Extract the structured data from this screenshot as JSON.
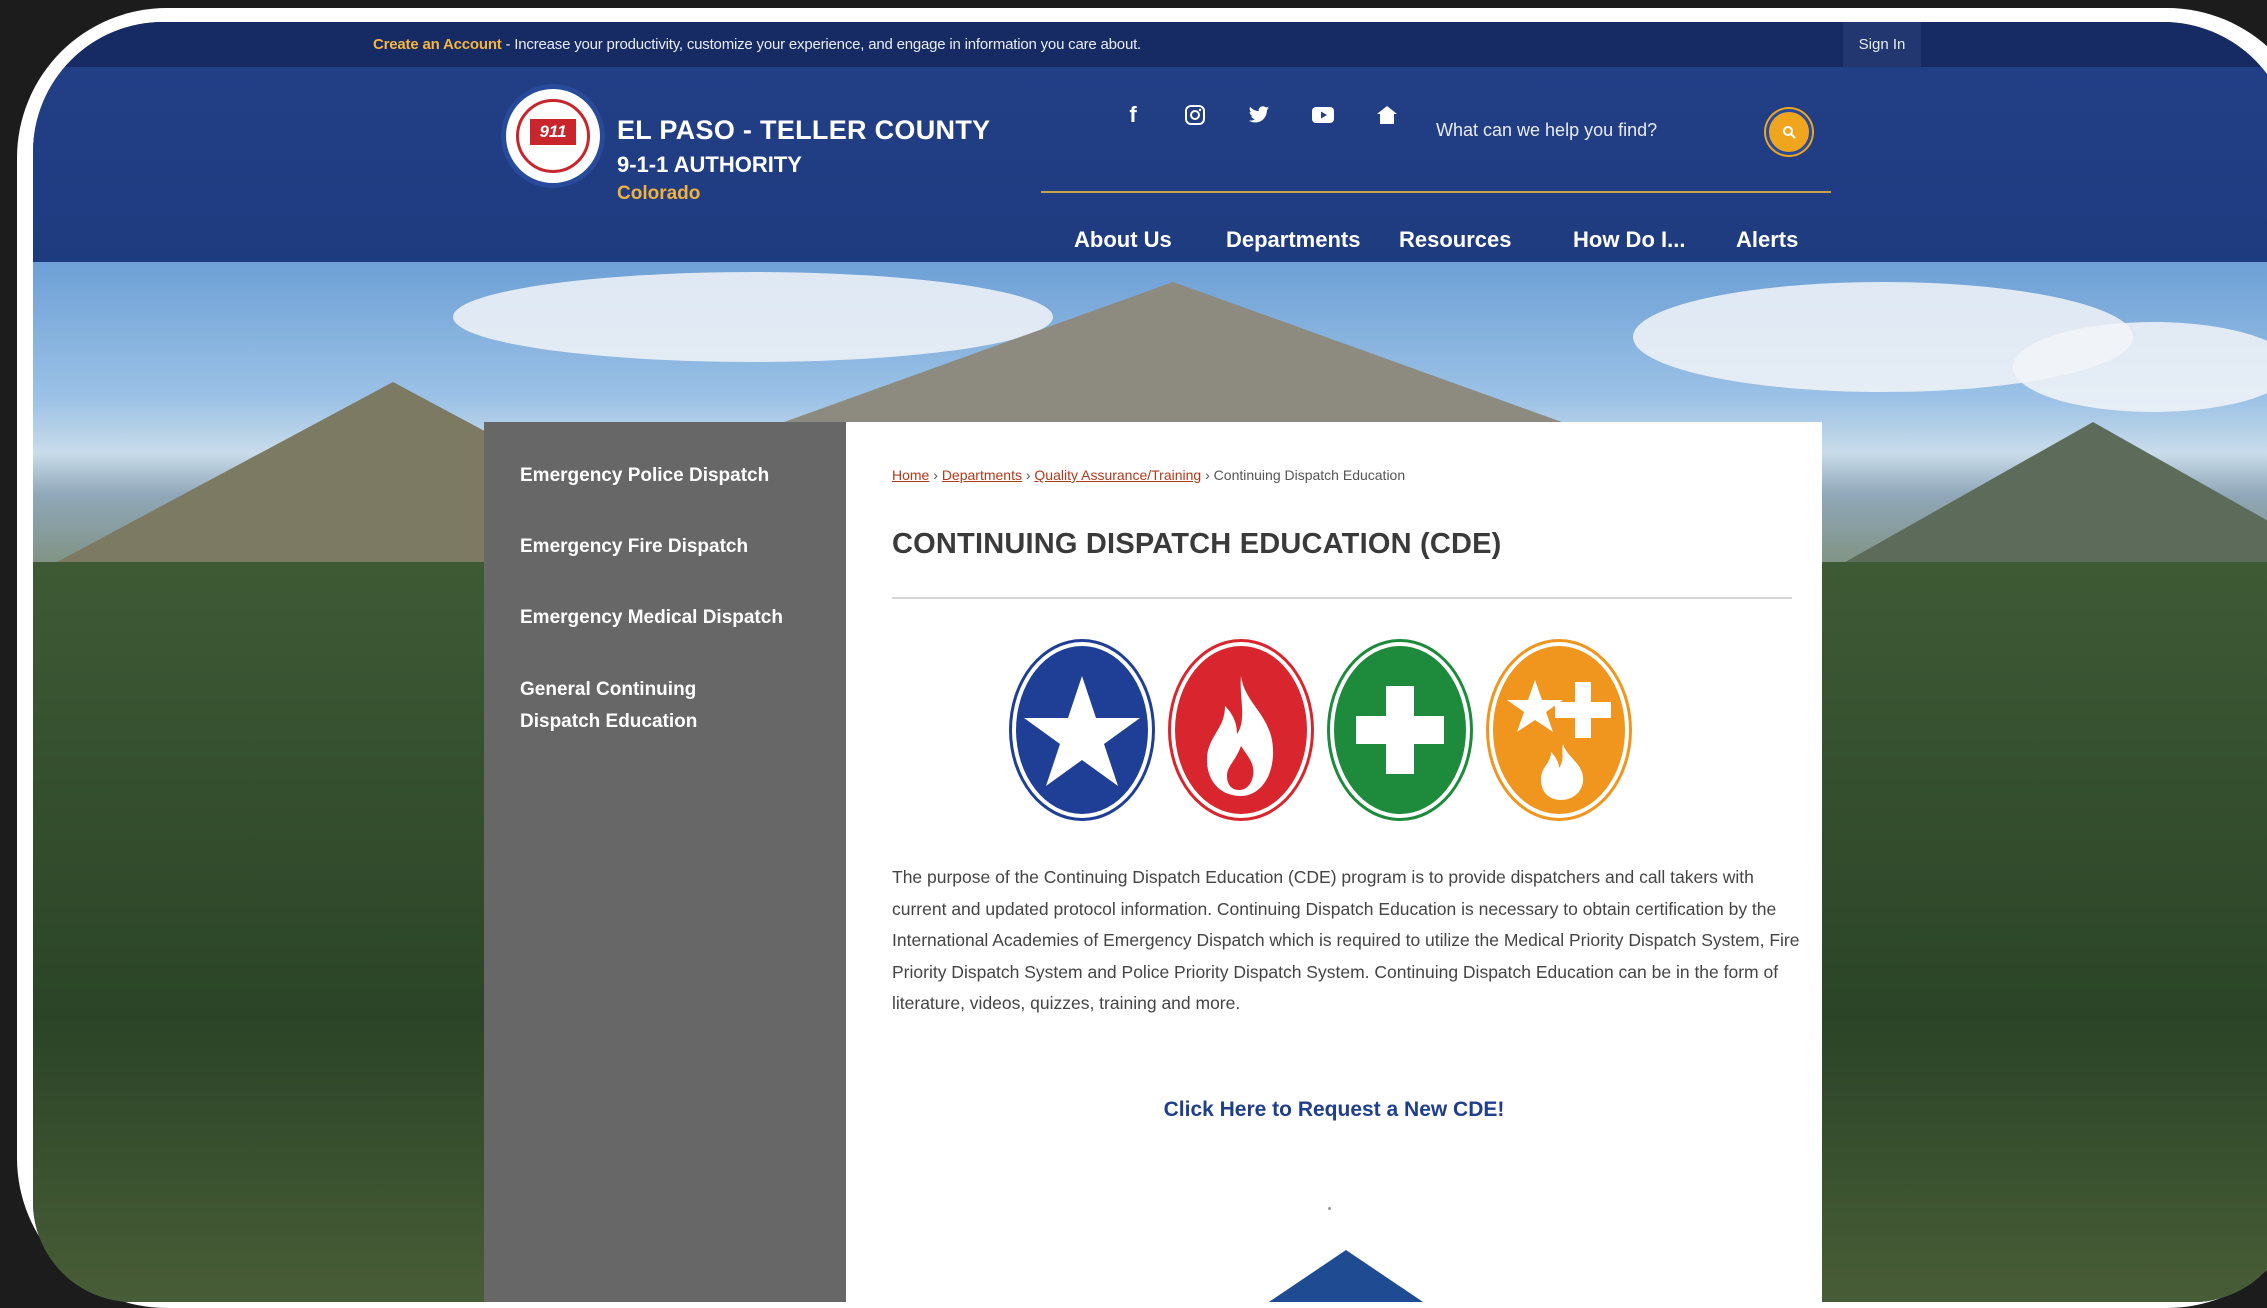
{
  "topbar": {
    "create_account": "Create an Account",
    "promo_text": " - Increase your productivity, customize your experience, and engage in information you care about.",
    "sign_in": "Sign In"
  },
  "header": {
    "org_line1": "EL PASO - TELLER COUNTY",
    "org_line2": "9-1-1 AUTHORITY",
    "org_line3": "Colorado",
    "logo_text": "911",
    "search_placeholder": "What can we help you find?",
    "social_icons": [
      "facebook-icon",
      "instagram-icon",
      "twitter-icon",
      "youtube-icon",
      "nextdoor-icon"
    ]
  },
  "nav": {
    "items": [
      "About Us",
      "Departments",
      "Resources",
      "How Do I...",
      "Alerts"
    ]
  },
  "sidebar": {
    "items": [
      "Emergency Police Dispatch",
      "Emergency Fire Dispatch",
      "Emergency Medical Dispatch",
      "General Continuing Dispatch Education"
    ]
  },
  "breadcrumb": {
    "home": "Home",
    "departments": "Departments",
    "qa": "Quality Assurance/Training",
    "current": "Continuing Dispatch Education",
    "sep": " › "
  },
  "page": {
    "title": "CONTINUING DISPATCH EDUCATION (CDE)",
    "body": "The purpose of the Continuing Dispatch Education (CDE) program is to provide dispatchers and call takers with current and updated protocol information.  Continuing Dispatch Education is necessary to obtain certification by the International Academies of Emergency Dispatch which is required to utilize the Medical Priority Dispatch System, Fire Priority Dispatch System and Police Priority Dispatch System.  Continuing Dispatch Education can be in the form of literature, videos, quizzes, training and more.",
    "cta": "Click Here to Request a New CDE!"
  },
  "badges": [
    {
      "name": "police-star-icon",
      "color": "#1f3f96"
    },
    {
      "name": "fire-flame-icon",
      "color": "#d9262e"
    },
    {
      "name": "medical-cross-icon",
      "color": "#1e8a3c"
    },
    {
      "name": "combined-dispatch-icon",
      "color": "#f0961e"
    }
  ]
}
